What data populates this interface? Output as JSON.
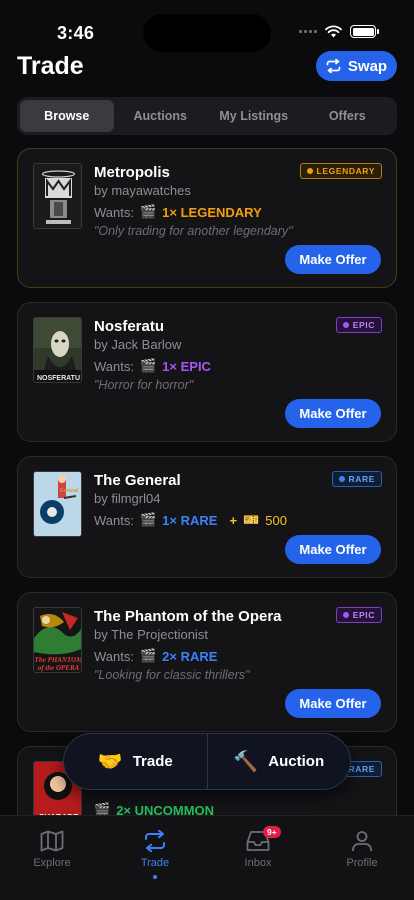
{
  "status": {
    "time": "3:46"
  },
  "header": {
    "title": "Trade",
    "swap_label": "Swap"
  },
  "tabs": [
    {
      "label": "Browse",
      "active": true
    },
    {
      "label": "Auctions",
      "active": false
    },
    {
      "label": "My Listings",
      "active": false
    },
    {
      "label": "Offers",
      "active": false
    }
  ],
  "listings": [
    {
      "title": "Metropolis",
      "by": "by mayawatches",
      "wants_label": "Wants:",
      "wants_value": "1× LEGENDARY",
      "wants_color": "#f59e0b",
      "extra": "",
      "quote": "\"Only trading for another legendary\"",
      "badge": "LEGENDARY",
      "badge_color": "#f59e0b",
      "button": "Make Offer"
    },
    {
      "title": "Nosferatu",
      "by": "by Jack Barlow",
      "wants_label": "Wants:",
      "wants_value": "1× EPIC",
      "wants_color": "#a855f7",
      "extra": "",
      "quote": "\"Horror for horror\"",
      "badge": "EPIC",
      "badge_color": "#a855f7",
      "button": "Make Offer"
    },
    {
      "title": "The General",
      "by": "by filmgrl04",
      "wants_label": "Wants:",
      "wants_value": "1× RARE",
      "wants_color": "#3b82f6",
      "extra_plus": "+",
      "extra": "500",
      "quote": "",
      "badge": "RARE",
      "badge_color": "#3b82f6",
      "button": "Make Offer"
    },
    {
      "title": "The Phantom of the Opera",
      "by": "by The Projectionist",
      "wants_label": "Wants:",
      "wants_value": "2× RARE",
      "wants_color": "#3b82f6",
      "extra": "",
      "quote": "\"Looking for classic thrillers\"",
      "badge": "EPIC",
      "badge_color": "#a855f7",
      "button": "Make Offer"
    },
    {
      "title": "",
      "by": "",
      "wants_label": "",
      "wants_value": "2× UNCOMMON",
      "wants_color": "#22c55e",
      "extra": "",
      "quote": "",
      "badge": "RARE",
      "badge_color": "#3b82f6",
      "button": ""
    }
  ],
  "float_bar": {
    "trade_label": "Trade",
    "auction_label": "Auction"
  },
  "tabbar": [
    {
      "label": "Explore",
      "icon": "map-icon",
      "active": false
    },
    {
      "label": "Trade",
      "icon": "swap-icon",
      "active": true
    },
    {
      "label": "Inbox",
      "icon": "inbox-icon",
      "active": false,
      "badge": "9+"
    },
    {
      "label": "Profile",
      "icon": "person-icon",
      "active": false
    }
  ]
}
